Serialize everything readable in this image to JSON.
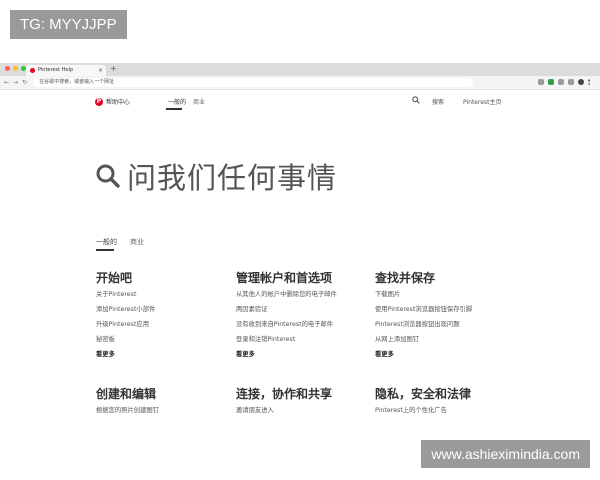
{
  "watermarks": {
    "top_left": "TG: MYYJJPP",
    "bottom_right": "www.ashieximindia.com"
  },
  "browser": {
    "tab_title": "Pinterest Help",
    "tab_close": "×",
    "new_tab": "+",
    "address_text": "在谷歌中搜索，或者输入一个网址"
  },
  "site": {
    "logo_text": "帮助中心",
    "nav": [
      "一般的",
      "商业"
    ],
    "search_label": "搜索",
    "home_label": "Pinterest主页"
  },
  "hero": {
    "text": "问我们任何事情"
  },
  "subtabs": [
    "一般的",
    "商业"
  ],
  "columns": [
    {
      "title": "开始吧",
      "links": [
        "关于Pinterest",
        "添加Pinterest小部件",
        "升级Pinterest应用",
        "秘密板"
      ],
      "more": "看更多"
    },
    {
      "title": "管理帐户和首选项",
      "links": [
        "从其他人的帐户中删除您的电子邮件",
        "两因素验证",
        "没有收到来自Pinterest的电子邮件",
        "登录和注销Pinterest"
      ],
      "more": "看更多"
    },
    {
      "title": "查找并保存",
      "links": [
        "下载图片",
        "使用Pinterest浏览器按钮保存引脚",
        "Pinterest浏览器按钮出现问题",
        "从网上添加图钉"
      ],
      "more": "看更多"
    },
    {
      "title": "创建和编辑",
      "links": [
        "根据您的照片创建图钉"
      ],
      "more": ""
    },
    {
      "title": "连接，协作和共享",
      "links": [
        "邀请朋友进入"
      ],
      "more": ""
    },
    {
      "title": "隐私，安全和法律",
      "links": [
        "Pinterest上的个性化广告"
      ],
      "more": ""
    }
  ],
  "colors": {
    "brand_red": "#e60023",
    "text_dark": "#333333",
    "watermark_bg": "#9a9a9a"
  }
}
